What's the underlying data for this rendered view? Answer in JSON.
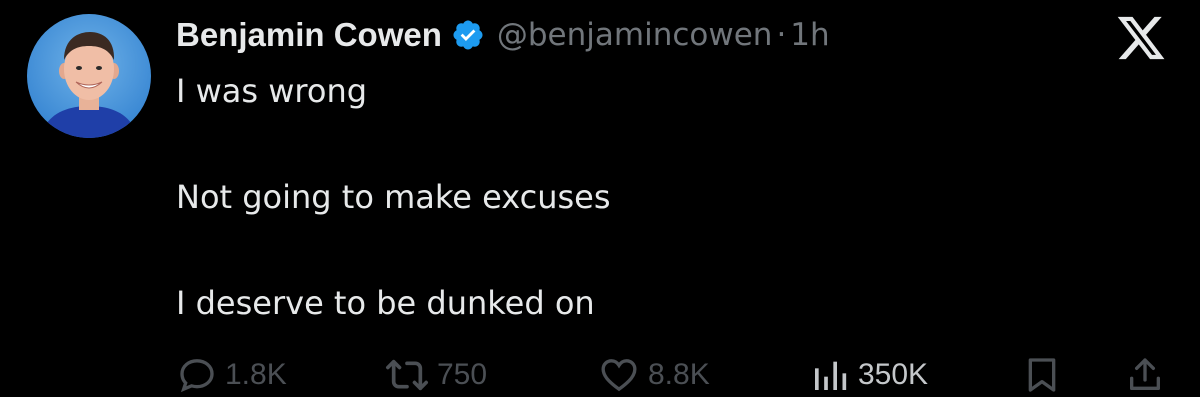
{
  "author": {
    "name": "Benjamin Cowen",
    "handle": "@benjamincowen",
    "separator": "·",
    "time": "1h",
    "verified": true
  },
  "tweet": {
    "lines": [
      "I was wrong",
      "Not going to make excuses",
      "I deserve to be dunked on"
    ]
  },
  "actions": {
    "replies": "1.8K",
    "retweets": "750",
    "likes": "8.8K",
    "views": "350K"
  },
  "icons": {
    "verified": "verified-badge-icon",
    "platform": "x-logo-icon",
    "reply": "reply-icon",
    "retweet": "retweet-icon",
    "like": "heart-icon",
    "views": "views-icon",
    "bookmark": "bookmark-icon",
    "share": "share-icon"
  },
  "colors": {
    "background": "#000000",
    "text": "#e7e9ea",
    "secondary": "#71767b",
    "verified": "#1d9bf0",
    "action_dim": "#4b4f54"
  }
}
